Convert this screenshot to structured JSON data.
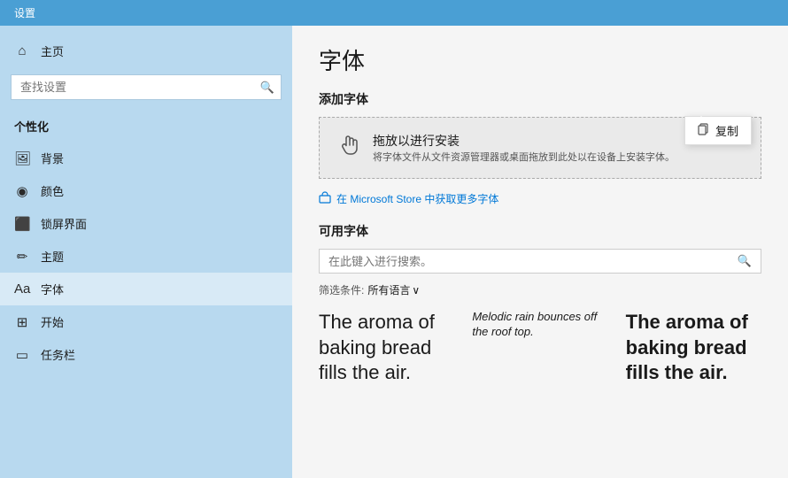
{
  "topbar": {
    "label": "设置"
  },
  "sidebar": {
    "search_placeholder": "查找设置",
    "section_label": "个性化",
    "items": [
      {
        "id": "home",
        "icon": "⌂",
        "label": "主页"
      },
      {
        "id": "background",
        "icon": "🖼",
        "label": "背景"
      },
      {
        "id": "color",
        "icon": "◉",
        "label": "颜色"
      },
      {
        "id": "lockscreen",
        "icon": "⬛",
        "label": "锁屏界面"
      },
      {
        "id": "theme",
        "icon": "✏",
        "label": "主题"
      },
      {
        "id": "font",
        "icon": "Aa",
        "label": "字体",
        "active": true
      },
      {
        "id": "start",
        "icon": "⊞",
        "label": "开始"
      },
      {
        "id": "taskbar",
        "icon": "▭",
        "label": "任务栏"
      }
    ]
  },
  "main": {
    "page_title": "字体",
    "add_font_section": "添加字体",
    "drop_zone": {
      "main_text": "拖放以进行安装",
      "sub_text": "将字体文件从文件资源管理器或桌面拖放到此处以在设备上安装字体。"
    },
    "context_menu": {
      "label": "复制"
    },
    "store_link": "在 Microsoft Store 中获取更多字体",
    "available_section": "可用字体",
    "font_search_placeholder": "在此键入进行搜索。",
    "filter_label": "筛选条件:",
    "filter_value": "所有语言",
    "font_previews": [
      {
        "id": "preview1",
        "style": "large",
        "text": "The aroma of baking bread fills the air."
      },
      {
        "id": "preview2",
        "style": "small",
        "text": "Melodic rain bounces off the roof top."
      },
      {
        "id": "preview3",
        "style": "bold",
        "text": "The aroma of baking bread fills the air."
      }
    ]
  }
}
